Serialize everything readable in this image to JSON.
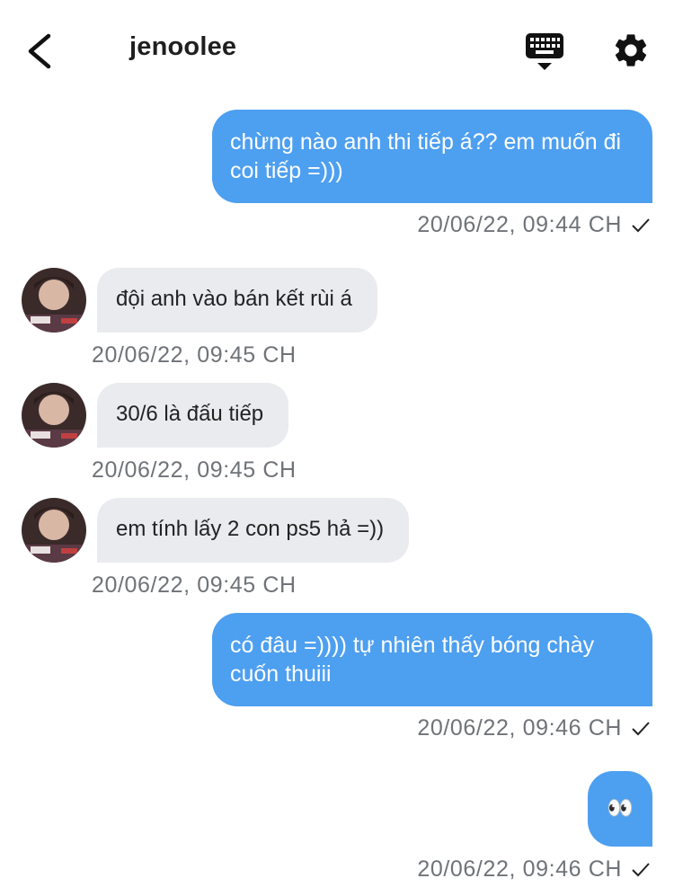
{
  "header": {
    "title": "jenoolee",
    "back_icon": "chevron-left-icon",
    "keyboard_icon": "keyboard-icon",
    "settings_icon": "gear-icon"
  },
  "colors": {
    "outgoing_bubble": "#4d9ff0",
    "incoming_bubble": "#e9ebef",
    "timestamp": "#6f7378"
  },
  "messages": [
    {
      "direction": "out",
      "text": "chừng nào anh thi tiếp á?? em muốn đi coi tiếp =)))",
      "timestamp": "20/06/22, 09:44 CH",
      "status_icon": "check-icon"
    },
    {
      "direction": "in",
      "text": "đội anh vào bán kết rùi á",
      "timestamp": "20/06/22, 09:45 CH"
    },
    {
      "direction": "in",
      "text": "30/6 là đấu tiếp",
      "timestamp": "20/06/22, 09:45 CH"
    },
    {
      "direction": "in",
      "text": "em tính lấy 2 con ps5 hả =))",
      "timestamp": "20/06/22, 09:45 CH"
    },
    {
      "direction": "out",
      "text": "có đâu =)))) tự nhiên thấy bóng chày cuốn thuiii",
      "timestamp": "20/06/22, 09:46 CH",
      "status_icon": "check-icon"
    },
    {
      "direction": "out",
      "text": "👀",
      "timestamp": "20/06/22, 09:46 CH",
      "status_icon": "check-icon"
    }
  ]
}
